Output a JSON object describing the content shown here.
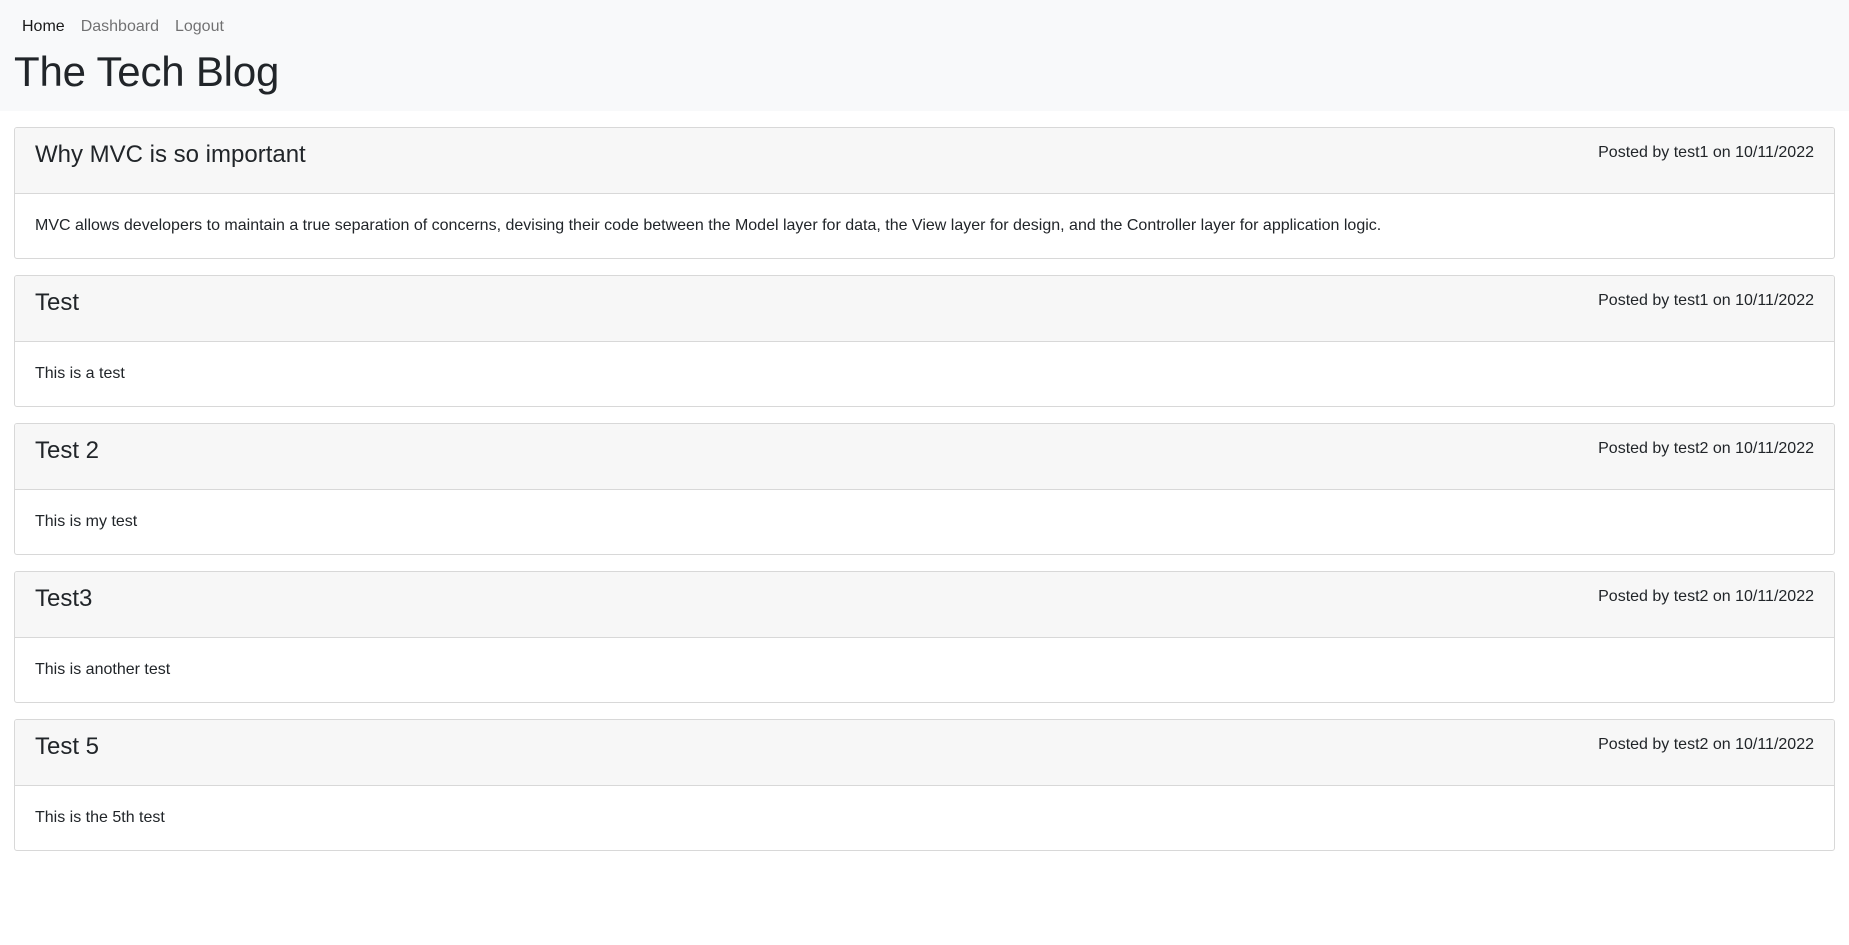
{
  "nav": {
    "items": [
      {
        "label": "Home",
        "active": true
      },
      {
        "label": "Dashboard",
        "active": false
      },
      {
        "label": "Logout",
        "active": false
      }
    ]
  },
  "site": {
    "title": "The Tech Blog"
  },
  "posts": [
    {
      "title": "Why MVC is so important",
      "meta": "Posted by test1 on 10/11/2022",
      "body": "MVC allows developers to maintain a true separation of concerns, devising their code between the Model layer for data, the View layer for design, and the Controller layer for application logic."
    },
    {
      "title": "Test",
      "meta": "Posted by test1 on 10/11/2022",
      "body": "This is a test"
    },
    {
      "title": "Test 2",
      "meta": "Posted by test2 on 10/11/2022",
      "body": "This is my test"
    },
    {
      "title": "Test3",
      "meta": "Posted by test2 on 10/11/2022",
      "body": "This is another test"
    },
    {
      "title": "Test 5",
      "meta": "Posted by test2 on 10/11/2022",
      "body": "This is the 5th test"
    }
  ],
  "colors": {
    "header_bg": "#f8f9fa",
    "card_header_bg": "#f7f7f7",
    "card_border": "#d8d8d8",
    "text": "#212529",
    "nav_muted": "#8c8c8c"
  }
}
